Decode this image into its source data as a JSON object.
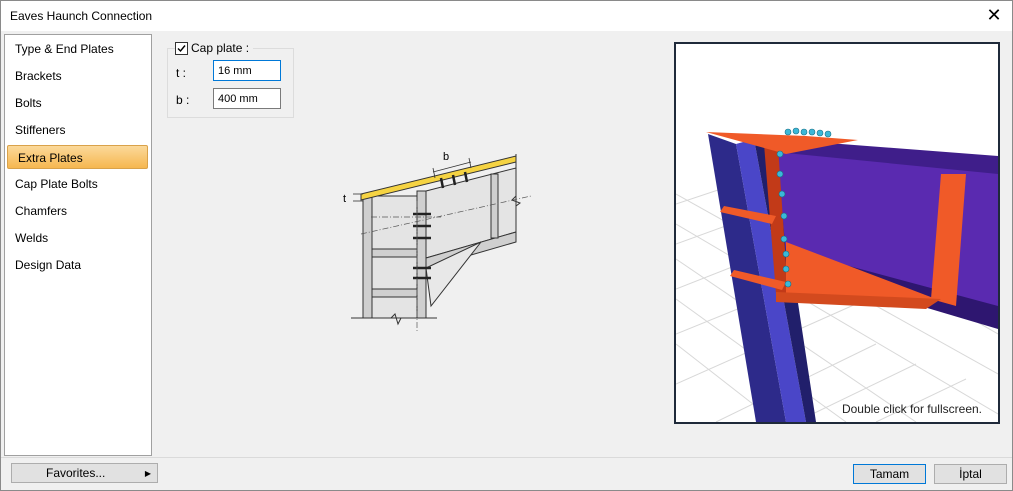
{
  "window": {
    "title": "Eaves Haunch Connection"
  },
  "sidebar": {
    "items": [
      {
        "label": "Type & End Plates"
      },
      {
        "label": "Brackets"
      },
      {
        "label": "Bolts"
      },
      {
        "label": "Stiffeners"
      },
      {
        "label": "Extra Plates"
      },
      {
        "label": "Cap Plate Bolts"
      },
      {
        "label": "Chamfers"
      },
      {
        "label": "Welds"
      },
      {
        "label": "Design Data"
      }
    ],
    "active_index": 4
  },
  "cap_plate": {
    "label": "Cap plate :",
    "checked": true,
    "t_label": "t :",
    "t_value": "16 mm",
    "b_label": "b :",
    "b_value": "400 mm"
  },
  "diagram": {
    "b_label": "b",
    "t_label": "t"
  },
  "preview": {
    "hint": "Double click for fullscreen."
  },
  "footer": {
    "favorites": "Favorites...",
    "ok": "Tamam",
    "cancel": "İptal"
  }
}
